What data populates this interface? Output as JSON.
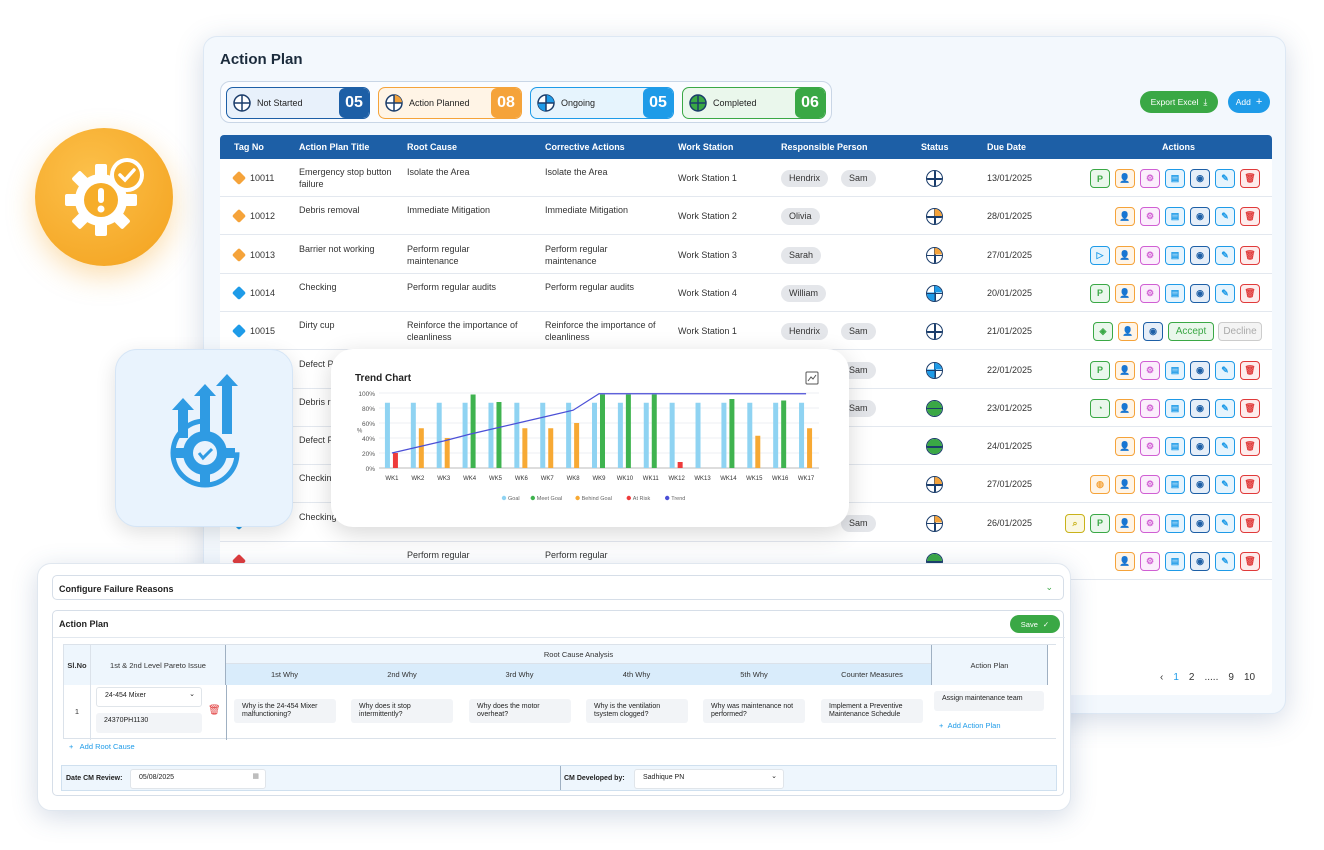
{
  "main": {
    "title": "Action Plan",
    "status_cards": [
      {
        "label": "Not Started",
        "count": "05",
        "color": "#1d5fa6"
      },
      {
        "label": "Action Planned",
        "count": "08",
        "color": "#f5a33a"
      },
      {
        "label": "Ongoing",
        "count": "05",
        "color": "#1e9be8"
      },
      {
        "label": "Completed",
        "count": "06",
        "color": "#3aa845"
      }
    ],
    "export_label": "Export Excel",
    "add_label": "Add",
    "columns": [
      "Tag No",
      "Action Plan Title",
      "Root Cause",
      "Corrective Actions",
      "Work Station",
      "Responsible Person",
      "Status",
      "Due Date",
      "Actions"
    ],
    "rows": [
      {
        "tag": "10011",
        "title": "Emergency stop button failure",
        "root": "Isolate the Area",
        "corrective": "Isolate the Area",
        "station": "Work Station 1",
        "people": [
          "Hendrix",
          "Sam"
        ],
        "status": "not-started",
        "due": "13/01/2025"
      },
      {
        "tag": "10012",
        "title": "Debris removal",
        "root": "Immediate Mitigation",
        "corrective": "Immediate Mitigation",
        "station": "Work Station 2",
        "people": [
          "Olivia"
        ],
        "status": "planned",
        "due": "28/01/2025"
      },
      {
        "tag": "10013",
        "title": "Barrier not working",
        "root": "Perform regular maintenance",
        "corrective": "Perform regular maintenance",
        "station": "Work Station 3",
        "people": [
          "Sarah"
        ],
        "status": "planned",
        "due": "27/01/2025"
      },
      {
        "tag": "10014",
        "title": "Checking",
        "root": "Perform regular audits",
        "corrective": "Perform regular audits",
        "station": "Work Station 4",
        "people": [
          "William"
        ],
        "status": "ongoing",
        "due": "20/01/2025"
      },
      {
        "tag": "10015",
        "title": "Dirty cup",
        "root": "Reinforce the importance of cleanliness",
        "corrective": "Reinforce the importance of cleanliness",
        "station": "Work Station 1",
        "people": [
          "Hendrix",
          "Sam"
        ],
        "status": "not-started",
        "due": "21/01/2025",
        "accept": "Accept",
        "decline": "Decline"
      },
      {
        "tag": "",
        "title": "Defect P",
        "root": "",
        "corrective": "",
        "station": "",
        "people": [
          "",
          "Sam"
        ],
        "status": "ongoing",
        "due": "22/01/2025"
      },
      {
        "tag": "",
        "title": "Debris r",
        "root": "",
        "corrective": "",
        "station": "",
        "people": [
          "",
          "Sam"
        ],
        "status": "completed",
        "due": "23/01/2025"
      },
      {
        "tag": "",
        "title": "Defect P",
        "root": "",
        "corrective": "",
        "station": "",
        "people": [],
        "status": "completed",
        "due": "24/01/2025"
      },
      {
        "tag": "",
        "title": "Checkin",
        "root": "",
        "corrective": "",
        "station": "",
        "people": [],
        "status": "planned",
        "due": "27/01/2025"
      },
      {
        "tag": "",
        "title": "Checking",
        "root": "",
        "corrective": "",
        "station": "",
        "people": [
          "",
          "Sam"
        ],
        "status": "planned",
        "due": "26/01/2025"
      },
      {
        "tag": "",
        "title": "",
        "root": "Perform regular",
        "corrective": "Perform regular",
        "station": "",
        "people": [],
        "status": "completed",
        "due": ""
      }
    ],
    "pager": {
      "prev": "‹",
      "pages": [
        "1",
        "2",
        ".....",
        "9",
        "10"
      ]
    }
  },
  "trend": {
    "title": "Trend Chart"
  },
  "chart_data": {
    "type": "bar",
    "title": "Trend Chart",
    "categories": [
      "WK1",
      "WK2",
      "WK3",
      "WK4",
      "WK5",
      "WK6",
      "WK7",
      "WK8",
      "WK9",
      "WK10",
      "WK11",
      "WK12",
      "WK13",
      "WK14",
      "WK15",
      "WK16",
      "WK17"
    ],
    "yticks": [
      "0%",
      "20%",
      "40%",
      "60%",
      "80%",
      "100%"
    ],
    "ylabel": "%",
    "ylim": [
      0,
      100
    ],
    "series": [
      {
        "name": "Goal",
        "color": "#8fd3f2",
        "values": [
          87,
          87,
          87,
          87,
          87,
          87,
          87,
          87,
          87,
          87,
          87,
          87,
          87,
          87,
          87,
          87,
          87
        ]
      },
      {
        "name": "Meet Goal",
        "color": "#3fb34f",
        "values": [
          0,
          0,
          0,
          98,
          88,
          0,
          0,
          0,
          98,
          98,
          98,
          0,
          0,
          92,
          0,
          90,
          0
        ]
      },
      {
        "name": "Behind Goal",
        "color": "#f7a934",
        "values": [
          0,
          53,
          40,
          0,
          0,
          53,
          53,
          60,
          0,
          0,
          0,
          0,
          0,
          0,
          43,
          0,
          53
        ]
      },
      {
        "name": "At Risk",
        "color": "#ee3b3b",
        "values": [
          20,
          0,
          0,
          0,
          0,
          0,
          0,
          0,
          0,
          0,
          0,
          8,
          0,
          0,
          0,
          0,
          0
        ]
      },
      {
        "name": "Trend",
        "type": "line",
        "color": "#4b4fd6",
        "values": [
          20,
          28,
          36,
          45,
          53,
          61,
          69,
          77,
          99,
          99,
          99,
          99,
          99,
          99,
          99,
          99,
          99
        ]
      }
    ]
  },
  "config": {
    "section_title": "Configure Failure Reasons",
    "panel_title": "Action Plan",
    "save_label": "Save",
    "sl_header": "Sl.No",
    "pareto_header": "1st & 2nd Level Pareto Issue",
    "rca_header": "Root Cause Analysis",
    "whys": [
      "1st Why",
      "2nd Why",
      "3rd Why",
      "4th Why",
      "5th Why"
    ],
    "counter_header": "Counter Measures",
    "action_header": "Action Plan",
    "row_no": "1",
    "pareto_select": "24-454 Mixer",
    "pareto_code": "24370PH1130",
    "why_answers": [
      "Why is the 24-454 Mixer malfunctioning?",
      "Why does it stop intermittently?",
      "Why does the motor overheat?",
      "Why is the ventilation tsystem clogged?",
      "Why was maintenance not performed?"
    ],
    "counter": "Implement a Preventive Maintenance Schedule",
    "action_value": "Assign maintenance team",
    "add_action_plan": "Add Action Plan",
    "add_root_cause": "Add Root Cause",
    "date_label": "Date CM Review:",
    "date_value": "05/08/2025",
    "developed_label": "CM Developed by:",
    "developed_value": "Sadhique PN"
  }
}
